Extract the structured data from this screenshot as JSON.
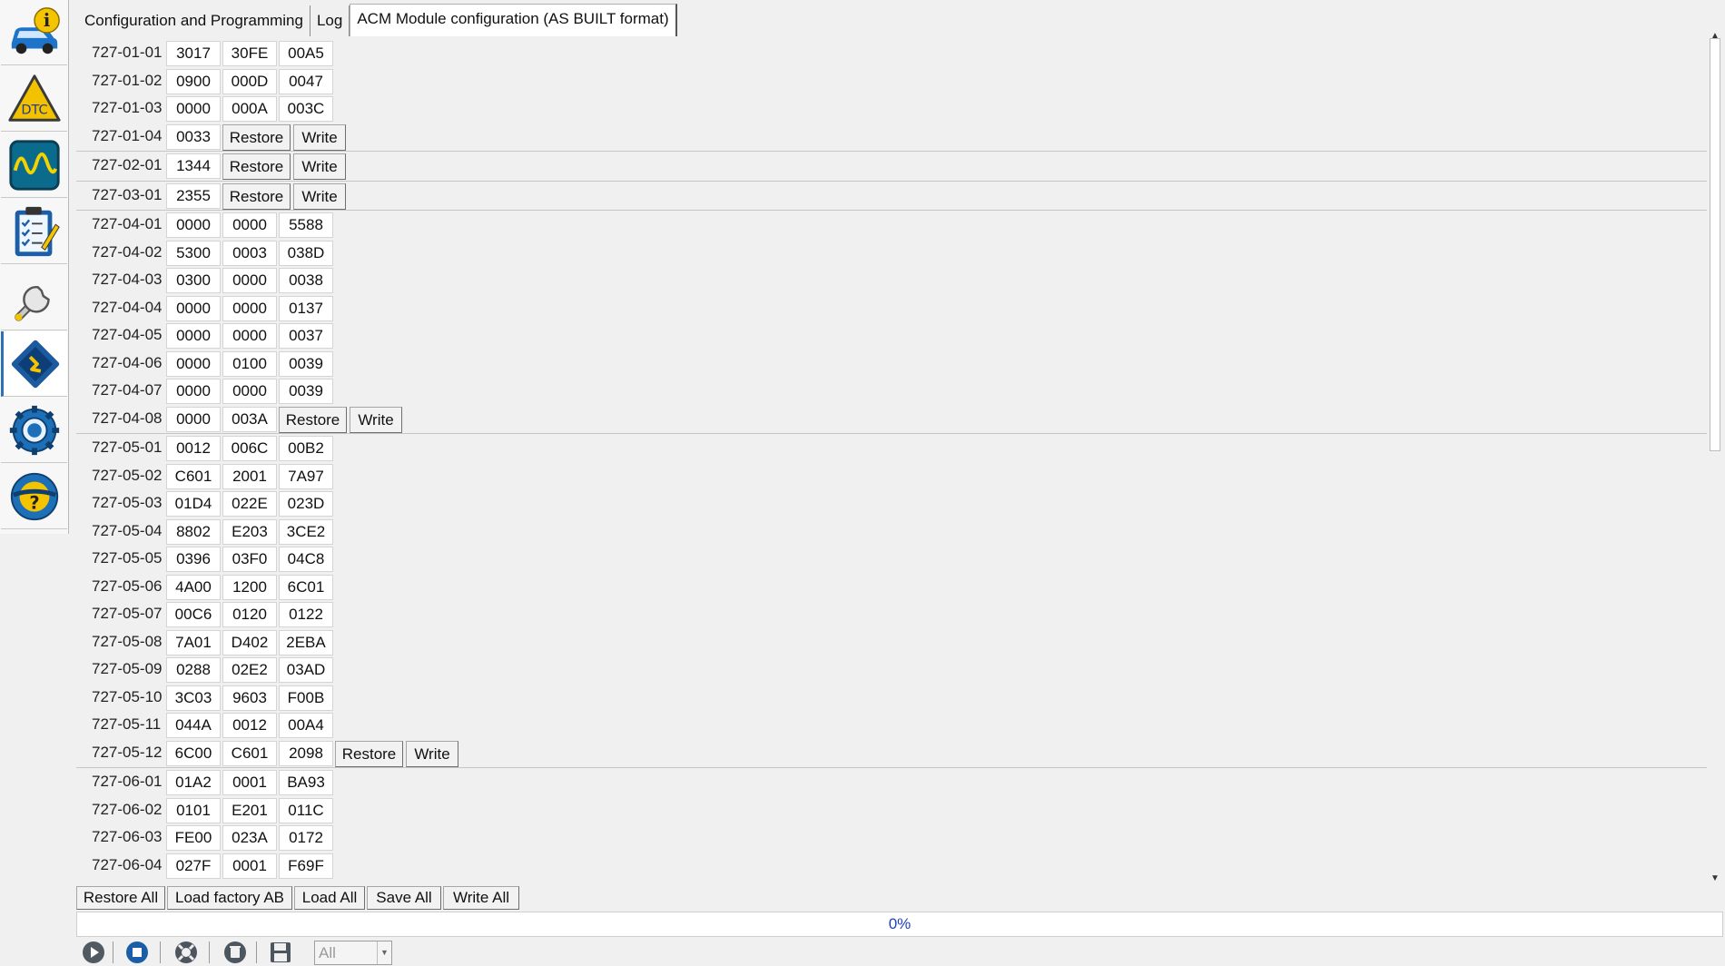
{
  "sidebar": {
    "items": [
      {
        "id": "vehicle-info",
        "icon": "car-info-icon"
      },
      {
        "id": "dtc",
        "icon": "dtc-warning-icon",
        "label": "DTC"
      },
      {
        "id": "oscilloscope",
        "icon": "waveform-icon"
      },
      {
        "id": "checklist",
        "icon": "clipboard-checklist-icon"
      },
      {
        "id": "service",
        "icon": "wrench-icon"
      },
      {
        "id": "programming",
        "icon": "chip-programming-icon",
        "active": true
      },
      {
        "id": "settings",
        "icon": "gear-icon"
      },
      {
        "id": "help",
        "icon": "steering-help-icon"
      }
    ]
  },
  "tabs": [
    {
      "label": "Configuration and Programming"
    },
    {
      "label": "Log"
    },
    {
      "label": "ACM Module configuration (AS BUILT format)",
      "active": true
    }
  ],
  "restore_label": "Restore",
  "write_label": "Write",
  "blocks": [
    {
      "rows": [
        {
          "id": "727-01-01",
          "values": [
            "3017",
            "30FE",
            "00A5"
          ]
        },
        {
          "id": "727-01-02",
          "values": [
            "0900",
            "000D",
            "0047"
          ]
        },
        {
          "id": "727-01-03",
          "values": [
            "0000",
            "000A",
            "003C"
          ]
        },
        {
          "id": "727-01-04",
          "values": [
            "0033"
          ]
        }
      ]
    },
    {
      "rows": [
        {
          "id": "727-02-01",
          "values": [
            "1344"
          ]
        }
      ]
    },
    {
      "rows": [
        {
          "id": "727-03-01",
          "values": [
            "2355"
          ]
        }
      ]
    },
    {
      "rows": [
        {
          "id": "727-04-01",
          "values": [
            "0000",
            "0000",
            "5588"
          ]
        },
        {
          "id": "727-04-02",
          "values": [
            "5300",
            "0003",
            "038D"
          ]
        },
        {
          "id": "727-04-03",
          "values": [
            "0300",
            "0000",
            "0038"
          ]
        },
        {
          "id": "727-04-04",
          "values": [
            "0000",
            "0000",
            "0137"
          ]
        },
        {
          "id": "727-04-05",
          "values": [
            "0000",
            "0000",
            "0037"
          ]
        },
        {
          "id": "727-04-06",
          "values": [
            "0000",
            "0100",
            "0039"
          ]
        },
        {
          "id": "727-04-07",
          "values": [
            "0000",
            "0000",
            "0039"
          ]
        },
        {
          "id": "727-04-08",
          "values": [
            "0000",
            "003A"
          ]
        }
      ]
    },
    {
      "rows": [
        {
          "id": "727-05-01",
          "values": [
            "0012",
            "006C",
            "00B2"
          ]
        },
        {
          "id": "727-05-02",
          "values": [
            "C601",
            "2001",
            "7A97"
          ]
        },
        {
          "id": "727-05-03",
          "values": [
            "01D4",
            "022E",
            "023D"
          ]
        },
        {
          "id": "727-05-04",
          "values": [
            "8802",
            "E203",
            "3CE2"
          ]
        },
        {
          "id": "727-05-05",
          "values": [
            "0396",
            "03F0",
            "04C8"
          ]
        },
        {
          "id": "727-05-06",
          "values": [
            "4A00",
            "1200",
            "6C01"
          ]
        },
        {
          "id": "727-05-07",
          "values": [
            "00C6",
            "0120",
            "0122"
          ]
        },
        {
          "id": "727-05-08",
          "values": [
            "7A01",
            "D402",
            "2EBA"
          ]
        },
        {
          "id": "727-05-09",
          "values": [
            "0288",
            "02E2",
            "03AD"
          ]
        },
        {
          "id": "727-05-10",
          "values": [
            "3C03",
            "9603",
            "F00B"
          ]
        },
        {
          "id": "727-05-11",
          "values": [
            "044A",
            "0012",
            "00A4"
          ]
        },
        {
          "id": "727-05-12",
          "values": [
            "6C00",
            "C601",
            "2098"
          ]
        }
      ]
    },
    {
      "rows": [
        {
          "id": "727-06-01",
          "values": [
            "01A2",
            "0001",
            "BA93"
          ]
        },
        {
          "id": "727-06-02",
          "values": [
            "0101",
            "E201",
            "011C"
          ]
        },
        {
          "id": "727-06-03",
          "values": [
            "FE00",
            "023A",
            "0172"
          ]
        },
        {
          "id": "727-06-04",
          "values": [
            "027F",
            "0001",
            "F69F"
          ]
        }
      ],
      "no_actions": true
    }
  ],
  "actions": [
    {
      "name": "restore-all-button",
      "label": "Restore All"
    },
    {
      "name": "load-factory-ab-button",
      "label": "Load factory AB"
    },
    {
      "name": "load-all-button",
      "label": "Load All"
    },
    {
      "name": "save-all-button",
      "label": "Save All"
    },
    {
      "name": "write-all-button",
      "label": "Write All"
    }
  ],
  "progress": {
    "text": "0%",
    "value": 0
  },
  "bottombar": {
    "icons": [
      "play-icon",
      "stop-icon",
      "lifebuoy-icon",
      "clear-icon",
      "save-icon"
    ],
    "filter": {
      "value": "All"
    }
  },
  "colors": {
    "accent": "#2f6fb8",
    "progress_text": "#1f3fbf"
  }
}
